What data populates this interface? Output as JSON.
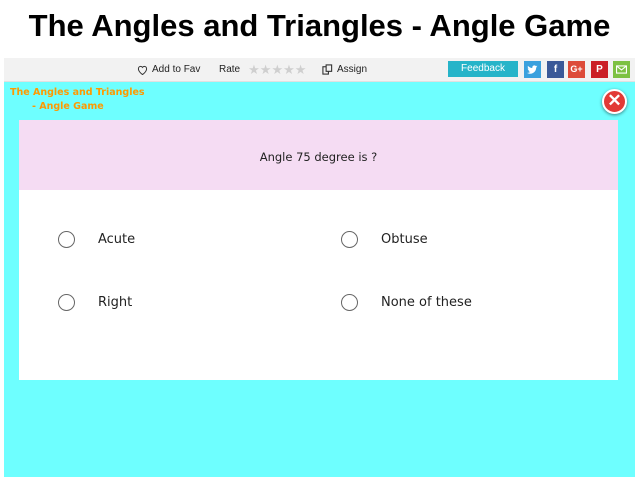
{
  "page": {
    "title": "The Angles and Triangles - Angle Game"
  },
  "toolbar": {
    "fav_label": "Add to Fav",
    "rate_label": "Rate",
    "star_count": 5,
    "assign_label": "Assign",
    "feedback_label": "Feedback",
    "social": [
      "twitter-icon",
      "facebook-icon",
      "google-plus-icon",
      "pinterest-icon",
      "email-icon"
    ]
  },
  "game": {
    "logo_line1": "The Angles and Triangles",
    "logo_line2": "- Angle Game",
    "question": "Angle 75 degree is ?",
    "options": [
      "Acute",
      "Obtuse",
      "Right",
      "None of these"
    ],
    "colors": {
      "background": "#6effff",
      "question_band": "#f5dcf3",
      "logo": "#ff9900",
      "close": "#e23a36",
      "feedback": "#26b4c9"
    }
  }
}
